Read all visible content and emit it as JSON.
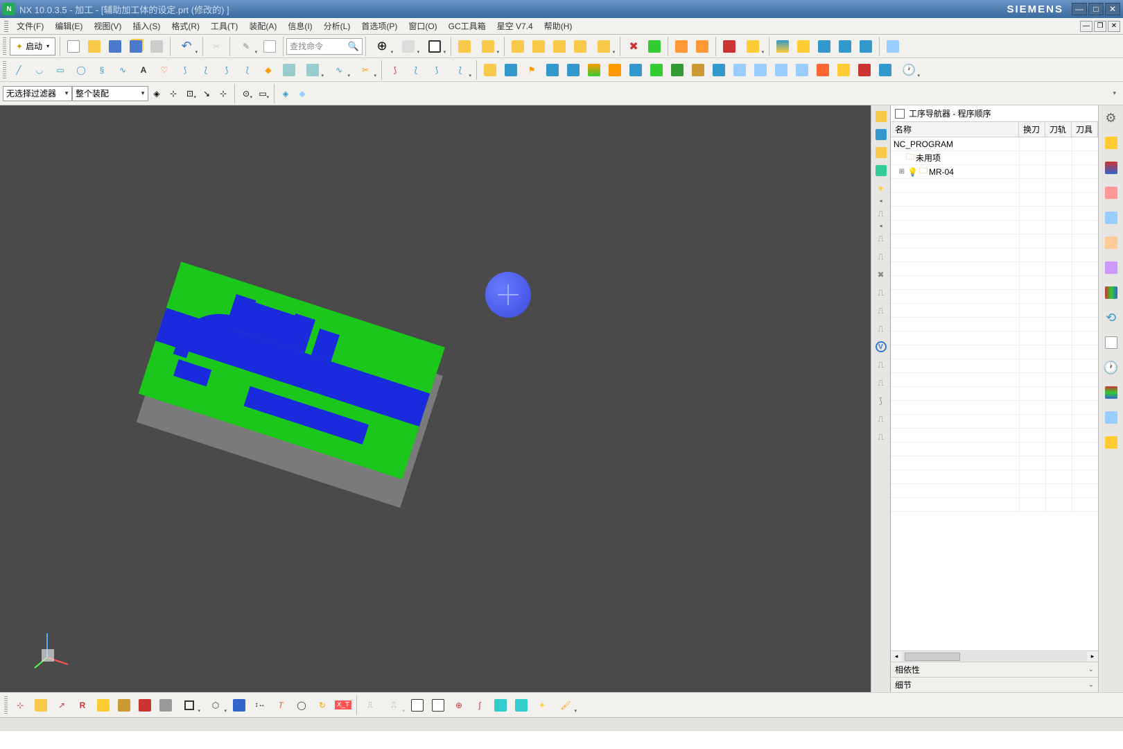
{
  "title": "NX 10.0.3.5 - 加工 - [辅助加工体的设定.prt  (修改的)  ]",
  "brand": "SIEMENS",
  "menu": [
    "文件(F)",
    "编辑(E)",
    "视图(V)",
    "插入(S)",
    "格式(R)",
    "工具(T)",
    "装配(A)",
    "信息(I)",
    "分析(L)",
    "首选项(P)",
    "窗口(O)",
    "GC工具箱",
    "星空 V7.4",
    "帮助(H)"
  ],
  "start_label": "启动",
  "search_placeholder": "查找命令",
  "filter1": "无选择过滤器",
  "filter2": "整个装配",
  "navigator": {
    "title": "工序导航器 - 程序顺序",
    "columns": [
      "名称",
      "换刀",
      "刀轨",
      "刀具"
    ],
    "root": "NC_PROGRAM",
    "items": [
      {
        "label": "未用项",
        "indent": 1
      },
      {
        "label": "MR-04",
        "indent": 1,
        "expandable": true
      }
    ],
    "sections": [
      "相依性",
      "细节"
    ]
  }
}
